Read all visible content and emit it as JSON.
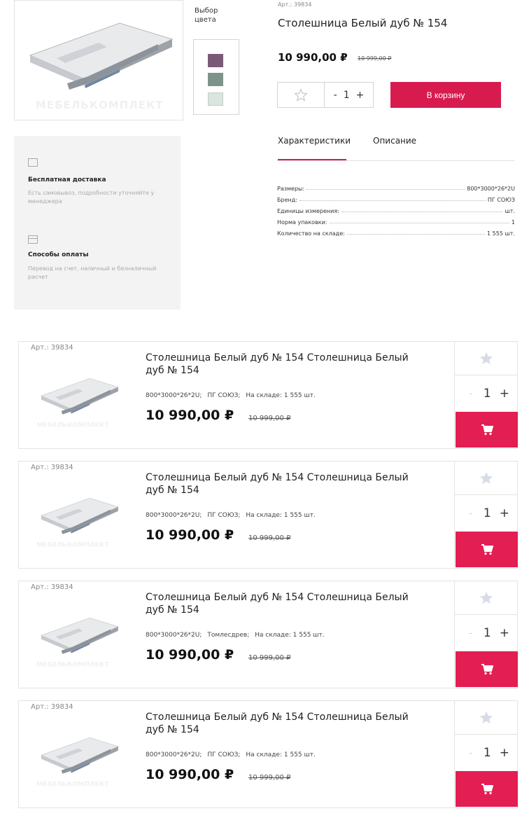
{
  "product": {
    "article": "Арт.: 39834",
    "title": "Столешница Белый дуб № 154",
    "price": "10 990,00 ₽",
    "old_price": "10 999,00 ₽",
    "color_choice_label": "Выбор цвета",
    "colors": [
      "#7b5a78",
      "#7e9488",
      "#dbe5df"
    ],
    "quantity": "1",
    "add_to_cart_label": "В корзину",
    "watermark": "МЕБЕЛЬКОМПЛЕКТ"
  },
  "tabs": [
    {
      "label": "Характеристики",
      "active": true
    },
    {
      "label": "Описание",
      "active": false
    }
  ],
  "specs": [
    {
      "key": "Размеры:",
      "value": "800*3000*26*2U"
    },
    {
      "key": "Бренд:",
      "value": "ПГ СОЮЗ"
    },
    {
      "key": "Единицы измерения:",
      "value": "шт."
    },
    {
      "key": "Норма упаковки:",
      "value": "1"
    },
    {
      "key": "Количество на складе:",
      "value": "1 555 шт."
    }
  ],
  "info": {
    "delivery_title": "Бесплатная доставка",
    "delivery_text": "Есть самовывоз, подробности уточняйте у менеджера",
    "payment_title": "Способы оплаты",
    "payment_text": "Перевод на счет, наличный и безналичный расчет"
  },
  "cards": [
    {
      "article": "Арт.: 39834",
      "title": "Столешница Белый дуб № 154 Столешница Белый дуб № 154",
      "size": "800*3000*26*2U;",
      "brand": "ПГ СОЮЗ;",
      "stock": "На складе: 1 555 шт.",
      "price": "10 990,00 ₽",
      "old_price": "10 999,00 ₽",
      "quantity": "1"
    },
    {
      "article": "Арт.: 39834",
      "title": "Столешница Белый дуб № 154 Столешница Белый дуб № 154",
      "size": "800*3000*26*2U;",
      "brand": "ПГ СОЮЗ;",
      "stock": "На складе: 1 555 шт.",
      "price": "10 990,00 ₽",
      "old_price": "10 999,00 ₽",
      "quantity": "1"
    },
    {
      "article": "Арт.: 39834",
      "title": "Столешница Белый дуб № 154 Столешница Белый дуб № 154",
      "size": "800*3000*26*2U;",
      "brand": "Томлесдрев;",
      "stock": "На складе: 1 555 шт.",
      "price": "10 990,00 ₽",
      "old_price": "10 999,00 ₽",
      "quantity": "1"
    },
    {
      "article": "Арт.: 39834",
      "title": "Столешница Белый дуб № 154 Столешница Белый дуб № 154",
      "size": "800*3000*26*2U;",
      "brand": "ПГ СОЮЗ;",
      "stock": "На складе: 1 555 шт.",
      "price": "10 990,00 ₽",
      "old_price": "10 999,00 ₽",
      "quantity": "1"
    }
  ],
  "icons": {
    "favorite": "star-icon",
    "cart": "cart-icon",
    "delivery": "box-icon",
    "payment": "card-icon"
  },
  "colors": {
    "accent": "#d81b4f"
  }
}
